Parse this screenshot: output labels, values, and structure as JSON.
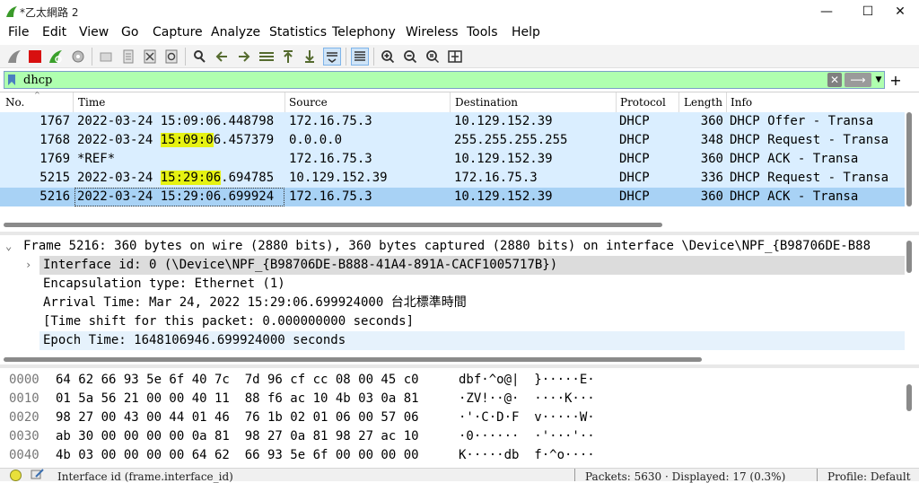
{
  "window": {
    "title": "*乙太網路 2",
    "minimize": "—",
    "maximize": "☐",
    "close": "✕"
  },
  "menu": [
    "File",
    "Edit",
    "View",
    "Go",
    "Capture",
    "Analyze",
    "Statistics",
    "Telephony",
    "Wireless",
    "Tools",
    "Help"
  ],
  "toolbar_icons": [
    "shark-fin-start-icon",
    "stop-capture-icon",
    "restart-capture-icon",
    "capture-options-icon",
    "open-file-icon",
    "save-file-icon",
    "close-file-icon",
    "reload-icon",
    "find-packet-icon",
    "go-back-icon",
    "go-forward-icon",
    "go-to-packet-icon",
    "go-first-icon",
    "go-last-icon",
    "autoscroll-icon",
    "colorize-icon",
    "zoom-in-icon",
    "zoom-out-icon",
    "zoom-normal-icon",
    "resize-columns-icon"
  ],
  "filter": {
    "value": "dhcp"
  },
  "packet_list": {
    "columns": [
      "No.",
      "Time",
      "Source",
      "Destination",
      "Protocol",
      "Length",
      "Info"
    ],
    "rows": [
      {
        "no": "1767",
        "time": "2022-03-24 15:09:06.448798",
        "time_pre": "",
        "time_hl": "",
        "time_post": "",
        "src": "172.16.75.3",
        "dst": "10.129.152.39",
        "proto": "DHCP",
        "len": "360",
        "info": "DHCP Offer    - Transa",
        "selected": false
      },
      {
        "no": "1768",
        "time": "",
        "time_pre": "2022-03-24 ",
        "time_hl": "15:09:0",
        "time_post": "6.457379",
        "src": "0.0.0.0",
        "dst": "255.255.255.255",
        "proto": "DHCP",
        "len": "348",
        "info": "DHCP Request  - Transa",
        "selected": false
      },
      {
        "no": "1769",
        "time": "*REF*",
        "time_pre": "",
        "time_hl": "",
        "time_post": "",
        "src": "172.16.75.3",
        "dst": "10.129.152.39",
        "proto": "DHCP",
        "len": "360",
        "info": "DHCP ACK      - Transa",
        "selected": false
      },
      {
        "no": "5215",
        "time": "",
        "time_pre": "2022-03-24 ",
        "time_hl": "15:29:06",
        "time_post": ".694785",
        "src": "10.129.152.39",
        "dst": "172.16.75.3",
        "proto": "DHCP",
        "len": "336",
        "info": "DHCP Request  - Transa",
        "selected": false
      },
      {
        "no": "5216",
        "time": "2022-03-24 15:29:06.699924",
        "time_pre": "",
        "time_hl": "",
        "time_post": "",
        "src": "172.16.75.3",
        "dst": "10.129.152.39",
        "proto": "DHCP",
        "len": "360",
        "info": "DHCP ACK      - Transa",
        "selected": true
      }
    ]
  },
  "details": [
    {
      "text": "Frame 5216: 360 bytes on wire (2880 bits), 360 bytes captured (2880 bits) on interface \\Device\\NPF_{B98706DE-B88",
      "indent": 0,
      "expander": "⌄",
      "bg": "#ffffff"
    },
    {
      "text": "Interface id: 0 (\\Device\\NPF_{B98706DE-B888-41A4-891A-CACF1005717B})",
      "indent": 1,
      "expander": "›",
      "bg": "#dcdcdc"
    },
    {
      "text": "Encapsulation type: Ethernet (1)",
      "indent": 1,
      "expander": "",
      "bg": "#ffffff"
    },
    {
      "text": "Arrival Time: Mar 24, 2022 15:29:06.699924000 台北標準時間",
      "indent": 1,
      "expander": "",
      "bg": "#ffffff"
    },
    {
      "text": "[Time shift for this packet: 0.000000000 seconds]",
      "indent": 1,
      "expander": "",
      "bg": "#ffffff"
    },
    {
      "text": "Epoch Time: 1648106946.699924000 seconds",
      "indent": 1,
      "expander": "",
      "bg": "#e6f2fc"
    }
  ],
  "bytes": [
    {
      "offset": "0000",
      "hex": "64 62 66 93 5e 6f 40 7c  7d 96 cf cc 08 00 45 c0",
      "ascii": "dbf·^o@|  }·····E·"
    },
    {
      "offset": "0010",
      "hex": "01 5a 56 21 00 00 40 11  88 f6 ac 10 4b 03 0a 81",
      "ascii": "·ZV!··@·  ····K···"
    },
    {
      "offset": "0020",
      "hex": "98 27 00 43 00 44 01 46  76 1b 02 01 06 00 57 06",
      "ascii": "·'·C·D·F  v·····W·"
    },
    {
      "offset": "0030",
      "hex": "ab 30 00 00 00 00 0a 81  98 27 0a 81 98 27 ac 10",
      "ascii": "·0······  ·'···'··"
    },
    {
      "offset": "0040",
      "hex": "4b 03 00 00 00 00 64 62  66 93 5e 6f 00 00 00 00",
      "ascii": "K·····db  f·^o····"
    }
  ],
  "status": {
    "field": "Interface id (frame.interface_id)",
    "packets": "Packets: 5630 · Displayed: 17 (0.3%)",
    "profile": "Profile: Default"
  }
}
